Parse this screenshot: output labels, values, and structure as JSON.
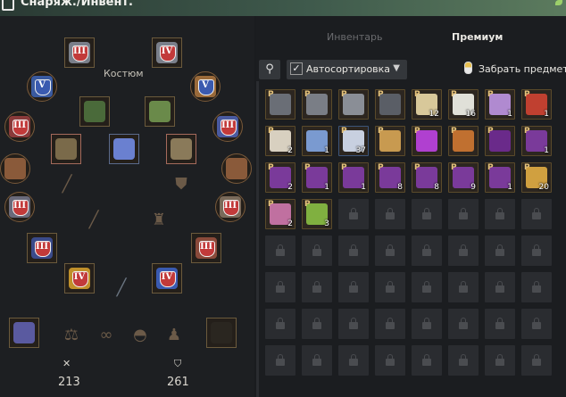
{
  "window": {
    "title": "Снаряж./Инвент."
  },
  "equipment": {
    "costume_label": "Костюм",
    "slots": [
      {
        "name": "helmet-slot",
        "tier": "III",
        "badge": "red",
        "art": "#7a7f8a"
      },
      {
        "name": "top-right-slot",
        "tier": "IV",
        "badge": "red",
        "art": "#7a7f8a"
      },
      {
        "name": "left-upper-slot",
        "tier": "V",
        "badge": "blue",
        "art": "#3a5aa0"
      },
      {
        "name": "right-upper-slot",
        "tier": "V",
        "badge": "blue",
        "art": "#9a6a3a"
      },
      {
        "name": "ring-left-slot",
        "tier": "III",
        "badge": "red",
        "art": "#8a3a3a"
      },
      {
        "name": "ring-right-slot",
        "tier": "III",
        "badge": "red",
        "art": "#4a5aa0"
      },
      {
        "name": "amulet-left-slot",
        "tier": "",
        "badge": "",
        "art": "#8a5a3a"
      },
      {
        "name": "amulet-right-slot",
        "tier": "",
        "badge": "",
        "art": "#8a5a3a"
      },
      {
        "name": "gloves-left-slot",
        "tier": "III",
        "badge": "red",
        "art": "#6a6a7a"
      },
      {
        "name": "gloves-right-slot",
        "tier": "III",
        "badge": "red",
        "art": "#7a6a5a"
      },
      {
        "name": "boots-left-slot",
        "tier": "III",
        "badge": "red",
        "art": "#3a4a8a"
      },
      {
        "name": "boots-right-slot",
        "tier": "III",
        "badge": "red",
        "art": "#8a4a3a"
      },
      {
        "name": "weapon-left-slot",
        "tier": "IV",
        "badge": "red",
        "art": "#c0902a"
      },
      {
        "name": "weapon-right-slot",
        "tier": "IV",
        "badge": "red",
        "art": "#3a5ab0"
      },
      {
        "name": "costume-hood-slot",
        "tier": "",
        "badge": "",
        "art": "#4a6a3a"
      },
      {
        "name": "costume-armor-slot",
        "tier": "",
        "badge": "",
        "art": "#6a8a4a"
      },
      {
        "name": "costume-left-slot",
        "tier": "",
        "badge": "",
        "art": "#7a6a4a"
      },
      {
        "name": "costume-crystal-slot",
        "tier": "",
        "badge": "",
        "art": "#6a80d0"
      },
      {
        "name": "costume-gloves-slot",
        "tier": "",
        "badge": "",
        "art": "#8a7a5a"
      },
      {
        "name": "book-slot",
        "tier": "",
        "badge": "",
        "art": "#5a5aa0"
      },
      {
        "name": "bow-slot",
        "tier": "",
        "badge": "",
        "art": "#2a2620"
      }
    ],
    "stats": {
      "attack": "213",
      "defense": "261"
    }
  },
  "inventory": {
    "tabs": [
      "Инвентарь",
      "Премиум"
    ],
    "active_tab": "Премиум",
    "autosort_label": "Автосортировка",
    "autosort_checked": "✓",
    "collect_label": "Забрать предмет",
    "items": [
      {
        "color": "#6a6e76",
        "p": "P",
        "count": ""
      },
      {
        "color": "#7a7e86",
        "p": "P",
        "count": ""
      },
      {
        "color": "#8a8e96",
        "p": "P",
        "count": ""
      },
      {
        "color": "#5a5e66",
        "p": "P",
        "count": ""
      },
      {
        "color": "#d8c89a",
        "p": "P",
        "count": "12"
      },
      {
        "color": "#e0e0d8",
        "p": "P",
        "count": "16"
      },
      {
        "color": "#b08ad0",
        "p": "P",
        "count": "1"
      },
      {
        "color": "#c04030",
        "p": "P",
        "count": "1"
      },
      {
        "color": "#d8d0c0",
        "p": "P",
        "count": "2"
      },
      {
        "color": "#7a9ad0",
        "p": "",
        "count": "1"
      },
      {
        "color": "#c8d0e0",
        "p": "P",
        "count": "37"
      },
      {
        "color": "#c89a50",
        "p": "P",
        "count": ""
      },
      {
        "color": "#b040d0",
        "p": "P",
        "count": ""
      },
      {
        "color": "#c07030",
        "p": "P",
        "count": ""
      },
      {
        "color": "#6a2a8a",
        "p": "P",
        "count": ""
      },
      {
        "color": "#7a3a9a",
        "p": "P",
        "count": "1"
      },
      {
        "color": "#7a3a9a",
        "p": "P",
        "count": "2"
      },
      {
        "color": "#7a3a9a",
        "p": "P",
        "count": "1"
      },
      {
        "color": "#7a3a9a",
        "p": "P",
        "count": "1"
      },
      {
        "color": "#7a3a9a",
        "p": "P",
        "count": "8"
      },
      {
        "color": "#7a3a9a",
        "p": "P",
        "count": "8"
      },
      {
        "color": "#7a3a9a",
        "p": "P",
        "count": "9"
      },
      {
        "color": "#7a3a9a",
        "p": "P",
        "count": "1"
      },
      {
        "color": "#d0a040",
        "p": "P",
        "count": "20"
      },
      {
        "color": "#c070a0",
        "p": "P",
        "count": "2"
      },
      {
        "color": "#80b040",
        "p": "P",
        "count": "3"
      }
    ]
  },
  "colors": {
    "accent_gold": "#6b5a3c",
    "locked_cell": "#2a2c30"
  }
}
